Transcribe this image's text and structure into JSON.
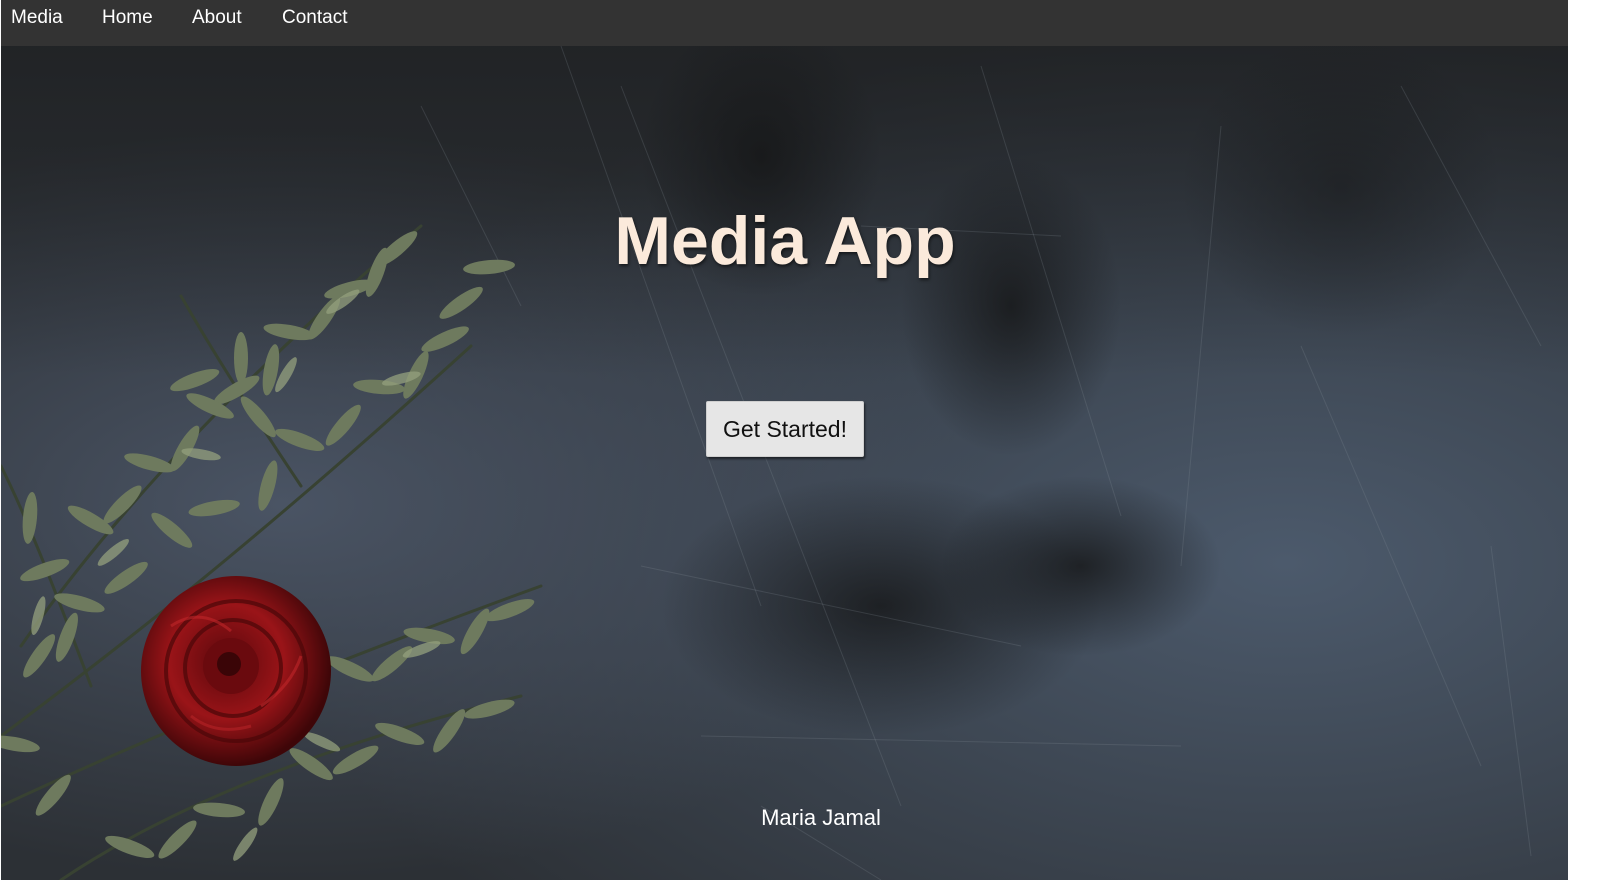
{
  "nav": {
    "brand": "Media",
    "links": [
      "Home",
      "About",
      "Contact"
    ]
  },
  "hero": {
    "title": "Media App",
    "cta_label": "Get Started!",
    "footer_name": "Maria Jamal"
  },
  "colors": {
    "navbar": "#333333",
    "title": "#fbeadb",
    "button": "#e6e6e6",
    "background": "#2c3035",
    "leaf": "#6e7a5e",
    "rose": "#9a1418"
  },
  "icons": {
    "hero_image": "dark-textured-background-with-olive-branches-and-red-rose"
  }
}
